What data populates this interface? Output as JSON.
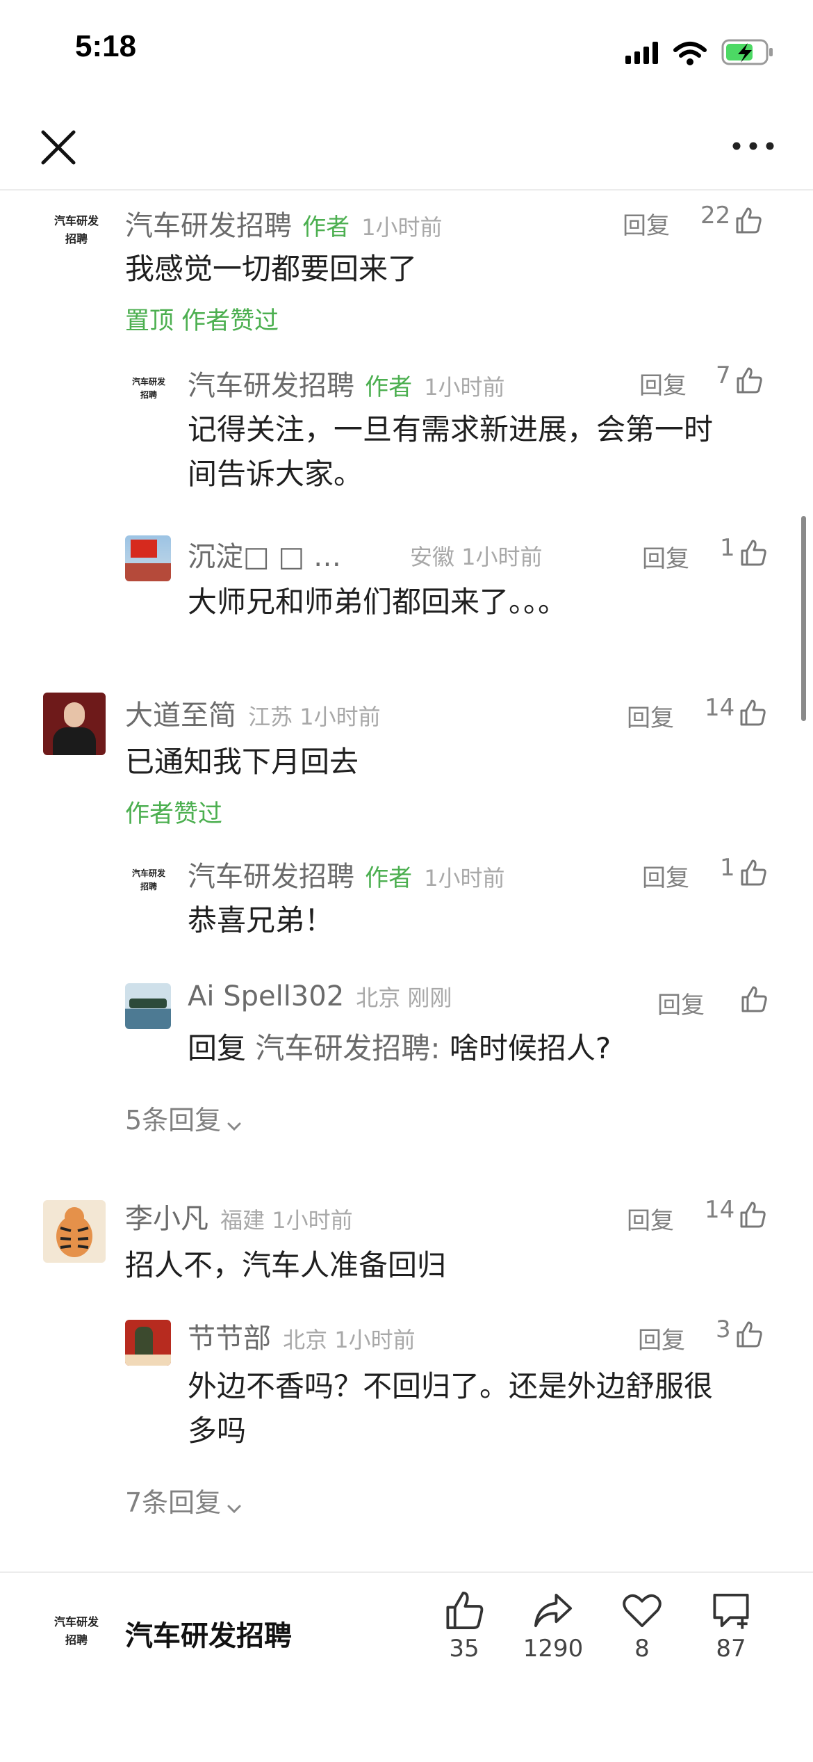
{
  "status_bar": {
    "time": "5:18"
  },
  "comments": [
    {
      "name": "汽车研发招聘",
      "author_tag": "作者",
      "meta": "1小时前",
      "reply": "回复",
      "likes": "22",
      "content": "我感觉一切都要回来了",
      "note": "置顶 作者赞过",
      "avatar_text": [
        "汽车研发",
        "招聘"
      ],
      "replies": [
        {
          "name": "汽车研发招聘",
          "author_tag": "作者",
          "meta": "1小时前",
          "reply": "回复",
          "likes": "7",
          "content_line1": "记得关注，一旦有需求新进展，会第一时",
          "content_line2": "间告诉大家。",
          "avatar_text": [
            "汽车研发",
            "招聘"
          ]
        },
        {
          "name": "沉淀□ □ …",
          "meta": "安徽 1小时前",
          "reply": "回复",
          "likes": "1",
          "content": "大师兄和师弟们都回来了。。。"
        }
      ]
    },
    {
      "name": "大道至简",
      "meta": "江苏 1小时前",
      "reply": "回复",
      "likes": "14",
      "content": "已通知我下月回去",
      "note": "作者赞过",
      "replies": [
        {
          "name": "汽车研发招聘",
          "author_tag": "作者",
          "meta": "1小时前",
          "reply": "回复",
          "likes": "1",
          "content": "恭喜兄弟！",
          "avatar_text": [
            "汽车研发",
            "招聘"
          ]
        },
        {
          "name": "Ai  Spell302",
          "meta": "北京 刚刚",
          "reply": "回复",
          "likes": "",
          "reply_prefix": "回复 ",
          "reply_target": "汽车研发招聘:",
          "content": " 啥时候招人?"
        }
      ],
      "more_replies": "5条回复"
    },
    {
      "name": "李小凡",
      "meta": "福建 1小时前",
      "reply": "回复",
      "likes": "14",
      "content": "招人不，汽车人准备回归",
      "replies": [
        {
          "name": "节节部",
          "meta": "北京 1小时前",
          "reply": "回复",
          "likes": "3",
          "content_line1": "外边不香吗？不回归了。还是外边舒服很",
          "content_line2": "多吗"
        }
      ],
      "more_replies": "7条回复"
    }
  ],
  "bottom_bar": {
    "name": "汽车研发招聘",
    "avatar_text": [
      "汽车研发",
      "招聘"
    ],
    "actions": [
      {
        "icon": "thumbs-up-icon",
        "count": "35"
      },
      {
        "icon": "share-icon",
        "count": "1290"
      },
      {
        "icon": "heart-icon",
        "count": "8"
      },
      {
        "icon": "comment-add-icon",
        "count": "87"
      }
    ]
  },
  "colors": {
    "accent_green": "#4caf50",
    "muted": "#808080"
  }
}
